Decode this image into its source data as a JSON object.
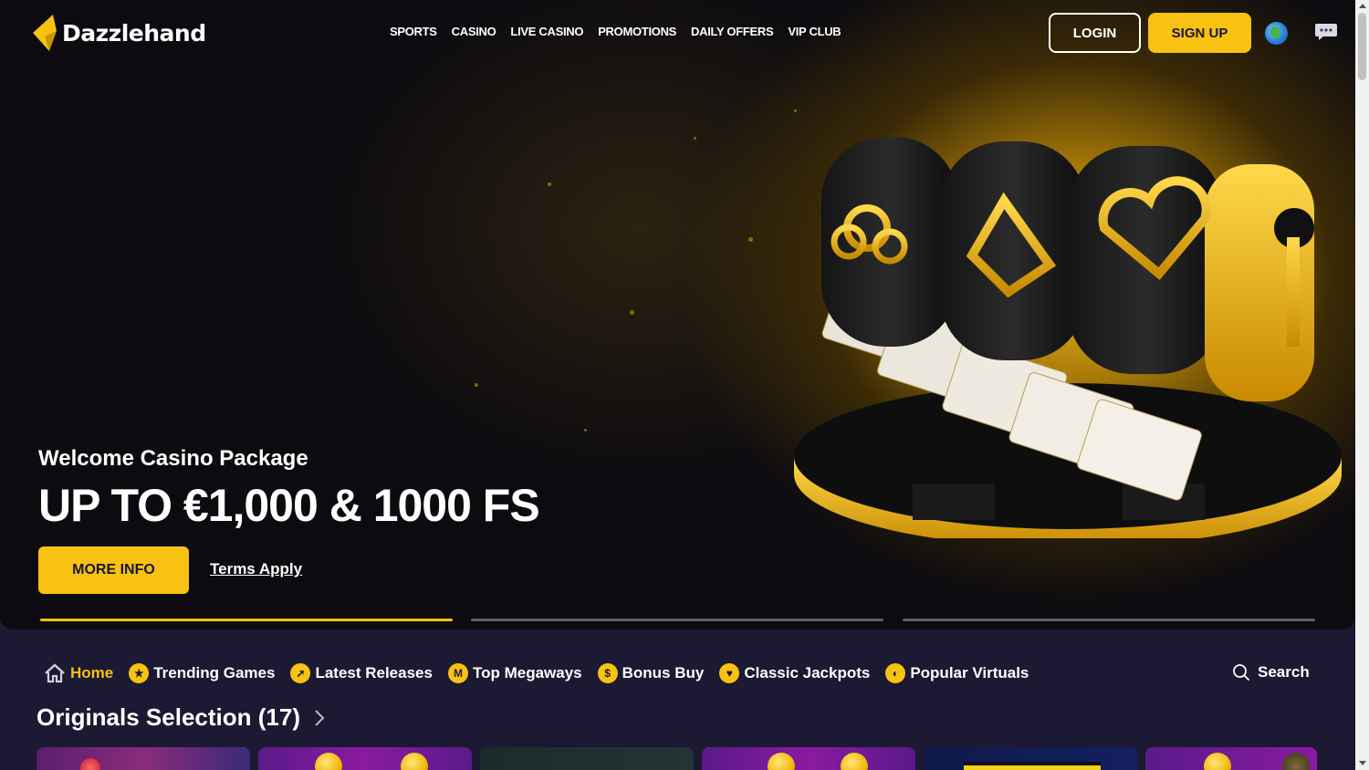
{
  "brand": {
    "name": "Dazzlehand",
    "accent": "#f7c211",
    "background": "#1c1933"
  },
  "nav": {
    "items": [
      {
        "label": "SPORTS"
      },
      {
        "label": "CASINO"
      },
      {
        "label": "LIVE CASINO"
      },
      {
        "label": "PROMOTIONS"
      },
      {
        "label": "DAILY OFFERS"
      },
      {
        "label": "VIP CLUB"
      }
    ],
    "login_label": "LOGIN",
    "signup_label": "SIGN UP",
    "language_icon": "globe-icon",
    "chat_icon": "chat-icon"
  },
  "hero": {
    "subtitle": "Welcome Casino Package",
    "title": "UP TO €1,000 & 1000 FS",
    "cta_label": "MORE INFO",
    "terms_label": "Terms Apply",
    "slides": [
      {
        "progress": 1.0
      },
      {
        "progress": 0.0
      },
      {
        "progress": 0.0
      }
    ]
  },
  "categories": {
    "items": [
      {
        "label": "Home",
        "icon": "home-icon",
        "active": true
      },
      {
        "label": "Trending Games",
        "icon": "star-icon",
        "active": false
      },
      {
        "label": "Latest Releases",
        "icon": "rocket-icon",
        "active": false
      },
      {
        "label": "Top Megaways",
        "icon": "megaways-icon",
        "active": false
      },
      {
        "label": "Bonus Buy",
        "icon": "bonus-buy-icon",
        "active": false
      },
      {
        "label": "Classic Jackpots",
        "icon": "jackpot-icon",
        "active": false
      },
      {
        "label": "Popular Virtuals",
        "icon": "virtuals-icon",
        "active": false
      }
    ],
    "search_label": "Search"
  },
  "section": {
    "title": "Originals Selection (17)"
  }
}
